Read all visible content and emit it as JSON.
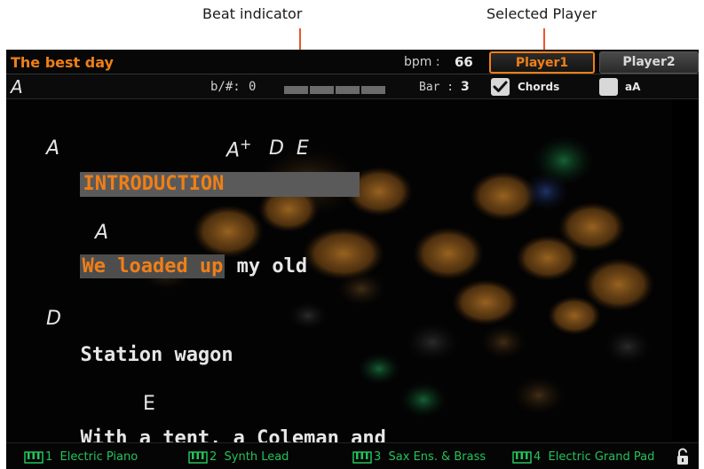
{
  "callouts": {
    "beat_indicator": "Beat indicator",
    "selected_player": "Selected Player"
  },
  "header": {
    "song_title": "The best day",
    "bpm_label": "bpm :",
    "bpm_value": "66",
    "players": [
      "Player1",
      "Player2"
    ],
    "selected_player": "Player1"
  },
  "status": {
    "key": "A",
    "transpose_label": "b/#:",
    "transpose_value": "0",
    "beat_segments": 4,
    "bar_label": "Bar :",
    "bar_value": "3",
    "chords_label": "Chords",
    "chords_checked": true,
    "case_label": "aA",
    "case_checked": false
  },
  "lyrics": {
    "line1_chords_a": "A",
    "line1_chords_b": "A",
    "line1_chords_b_sup": "+",
    "line1_chords_c": "D  E",
    "line2_section": "INTRODUCTION",
    "line3_chord": "A",
    "line4_highlight": "We loaded up",
    "line4_rest": " my old",
    "line5_chord": "D",
    "line6_text": "Station wagon",
    "line7_chord": "E",
    "line8_text": "With a tent, a Coleman and"
  },
  "tracks": [
    {
      "number": "1",
      "name": "Electric Piano"
    },
    {
      "number": "2",
      "name": "Synth Lead"
    },
    {
      "number": "3",
      "name": "Sax Ens. & Brass"
    },
    {
      "number": "4",
      "name": "Electric Grand Pad"
    }
  ],
  "colors": {
    "accent_orange": "#f07f16",
    "track_green": "#22c45a",
    "callout_line": "#e8572a"
  }
}
